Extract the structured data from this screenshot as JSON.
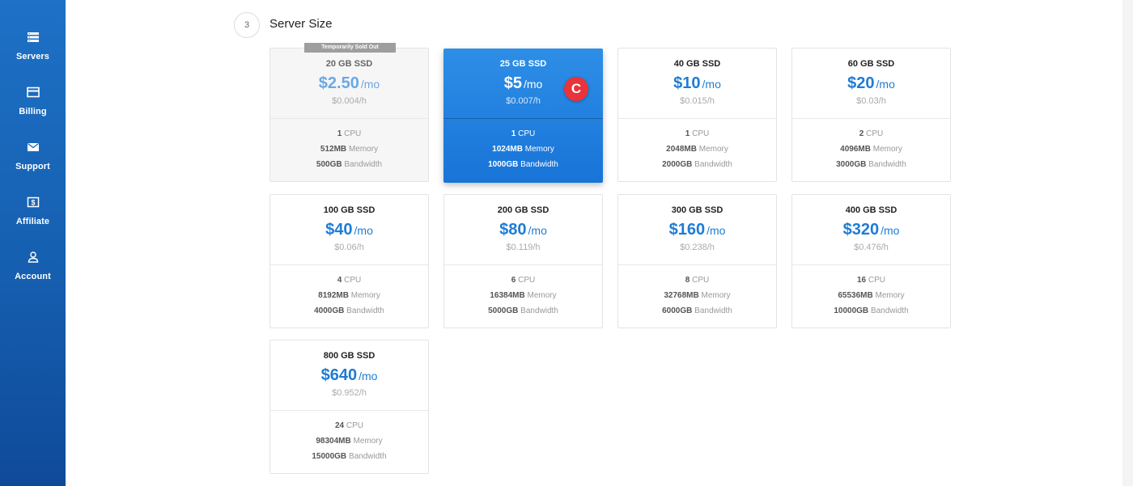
{
  "sidebar": {
    "items": [
      {
        "label": "Servers",
        "icon": "servers-icon"
      },
      {
        "label": "Billing",
        "icon": "credit-card-icon"
      },
      {
        "label": "Support",
        "icon": "envelope-icon"
      },
      {
        "label": "Affiliate",
        "icon": "dollar-bill-icon"
      },
      {
        "label": "Account",
        "icon": "user-icon"
      }
    ]
  },
  "section": {
    "step": "3",
    "title": "Server Size"
  },
  "sold_out_label": "Temporarily Sold Out",
  "cursor_marker": "C",
  "plans": [
    {
      "size": "20 GB SSD",
      "price": "$2.50",
      "per": "/mo",
      "hourly": "$0.004/h",
      "cpu": "1",
      "cpu_label": "CPU",
      "memory": "512MB",
      "memory_label": "Memory",
      "bandwidth": "500GB",
      "bandwidth_label": "Bandwidth",
      "state": "sold-out"
    },
    {
      "size": "25 GB SSD",
      "price": "$5",
      "per": "/mo",
      "hourly": "$0.007/h",
      "cpu": "1",
      "cpu_label": "CPU",
      "memory": "1024MB",
      "memory_label": "Memory",
      "bandwidth": "1000GB",
      "bandwidth_label": "Bandwidth",
      "state": "selected"
    },
    {
      "size": "40 GB SSD",
      "price": "$10",
      "per": "/mo",
      "hourly": "$0.015/h",
      "cpu": "1",
      "cpu_label": "CPU",
      "memory": "2048MB",
      "memory_label": "Memory",
      "bandwidth": "2000GB",
      "bandwidth_label": "Bandwidth",
      "state": "normal"
    },
    {
      "size": "60 GB SSD",
      "price": "$20",
      "per": "/mo",
      "hourly": "$0.03/h",
      "cpu": "2",
      "cpu_label": "CPU",
      "memory": "4096MB",
      "memory_label": "Memory",
      "bandwidth": "3000GB",
      "bandwidth_label": "Bandwidth",
      "state": "normal"
    },
    {
      "size": "100 GB SSD",
      "price": "$40",
      "per": "/mo",
      "hourly": "$0.06/h",
      "cpu": "4",
      "cpu_label": "CPU",
      "memory": "8192MB",
      "memory_label": "Memory",
      "bandwidth": "4000GB",
      "bandwidth_label": "Bandwidth",
      "state": "normal"
    },
    {
      "size": "200 GB SSD",
      "price": "$80",
      "per": "/mo",
      "hourly": "$0.119/h",
      "cpu": "6",
      "cpu_label": "CPU",
      "memory": "16384MB",
      "memory_label": "Memory",
      "bandwidth": "5000GB",
      "bandwidth_label": "Bandwidth",
      "state": "normal"
    },
    {
      "size": "300 GB SSD",
      "price": "$160",
      "per": "/mo",
      "hourly": "$0.238/h",
      "cpu": "8",
      "cpu_label": "CPU",
      "memory": "32768MB",
      "memory_label": "Memory",
      "bandwidth": "6000GB",
      "bandwidth_label": "Bandwidth",
      "state": "normal"
    },
    {
      "size": "400 GB SSD",
      "price": "$320",
      "per": "/mo",
      "hourly": "$0.476/h",
      "cpu": "16",
      "cpu_label": "CPU",
      "memory": "65536MB",
      "memory_label": "Memory",
      "bandwidth": "10000GB",
      "bandwidth_label": "Bandwidth",
      "state": "normal"
    },
    {
      "size": "800 GB SSD",
      "price": "$640",
      "per": "/mo",
      "hourly": "$0.952/h",
      "cpu": "24",
      "cpu_label": "CPU",
      "memory": "98304MB",
      "memory_label": "Memory",
      "bandwidth": "15000GB",
      "bandwidth_label": "Bandwidth",
      "state": "normal"
    }
  ],
  "colors": {
    "sidebar": "#1669c0",
    "accent": "#1e7cd6",
    "selected": "#1874d8",
    "marker": "#e8343a"
  }
}
